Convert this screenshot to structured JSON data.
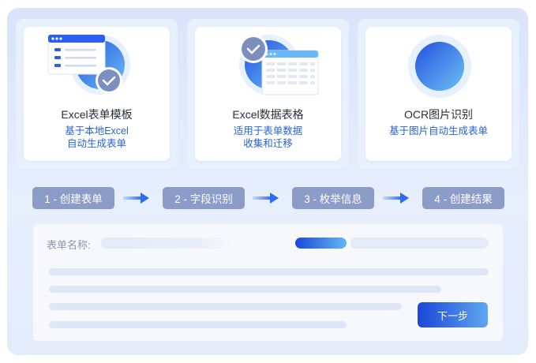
{
  "cards": [
    {
      "title": "Excel表单模板",
      "desc_line1": "基于本地Excel",
      "desc_line2": "自动生成表单"
    },
    {
      "title": "Excel数据表格",
      "desc_line1": "适用于表单数据",
      "desc_line2": "收集和迁移"
    },
    {
      "title": "OCR图片识别",
      "desc_line1": "基于图片自动生成表单",
      "desc_line2": ""
    }
  ],
  "steps": [
    {
      "label": "1 - 创建表单"
    },
    {
      "label": "2 - 字段识别"
    },
    {
      "label": "3 - 枚举信息"
    },
    {
      "label": "4 - 创建结果"
    }
  ],
  "form": {
    "name_label": "表单名称:",
    "next_label": "下一步"
  },
  "icons": {
    "card1": "excel-template-icon",
    "card2": "excel-table-icon",
    "card3": "ocr-circle-icon",
    "step_arrow": "arrow-right-icon"
  },
  "colors": {
    "accent": "#2563d6",
    "step_bg": "#8b9cc8",
    "button_start": "#1a47d8",
    "button_end": "#5fa6f0"
  }
}
